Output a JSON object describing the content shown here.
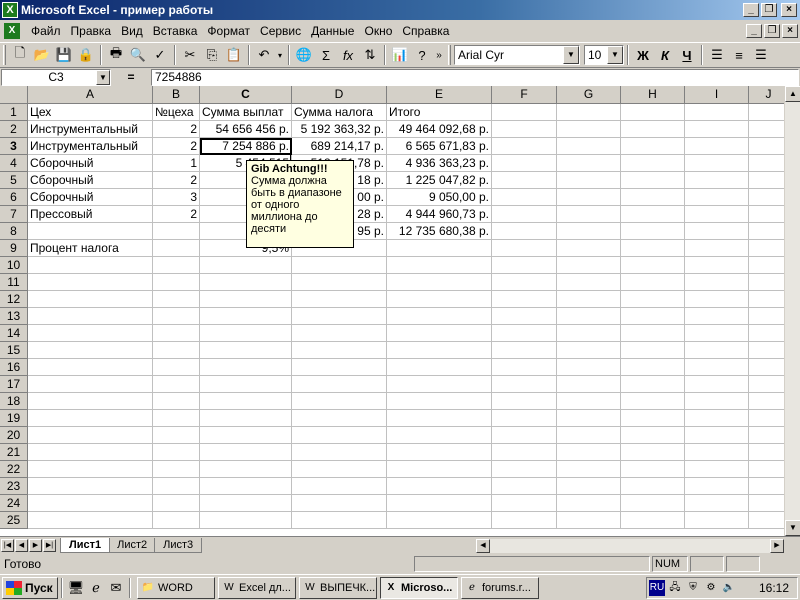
{
  "window": {
    "title": "Microsoft Excel - пример работы",
    "app_icon": "excel-icon"
  },
  "menu": [
    "Файл",
    "Правка",
    "Вид",
    "Вставка",
    "Формат",
    "Сервис",
    "Данные",
    "Окно",
    "Справка"
  ],
  "toolbar": {
    "font_name": "Arial Cyr",
    "font_size": "10",
    "bold": "Ж",
    "italic": "К",
    "underline": "Ч"
  },
  "formula_bar": {
    "name_box": "C3",
    "equals": "=",
    "formula": "7254886"
  },
  "columns": [
    "A",
    "B",
    "C",
    "D",
    "E",
    "F",
    "G",
    "H",
    "I",
    "J"
  ],
  "rows": [
    {
      "n": "1",
      "A": "Цех",
      "B": "№цеха",
      "C": "Сумма выплат",
      "D": "Сумма налога",
      "E": "Итого"
    },
    {
      "n": "2",
      "A": "Инструментальный",
      "B": "2",
      "C": "54 656 456 р.",
      "D": "5 192 363,32 р.",
      "E": "49 464 092,68 р."
    },
    {
      "n": "3",
      "A": "Инструментальный",
      "B": "2",
      "C": "7 254 886 р.",
      "D": "689 214,17 р.",
      "E": "6 565 671,83 р."
    },
    {
      "n": "4",
      "A": "Сборочный",
      "B": "1",
      "C": "5 454 515",
      "D": "518 151,78 р.",
      "E": "4 936 363,23 р."
    },
    {
      "n": "5",
      "A": "Сборочный",
      "B": "2",
      "C": "1 353",
      "D": "18 р.",
      "E": "1 225 047,82 р."
    },
    {
      "n": "6",
      "A": "Сборочный",
      "B": "3",
      "C": "10",
      "D": "00 р.",
      "E": "9 050,00 р."
    },
    {
      "n": "7",
      "A": "Прессовый",
      "B": "2",
      "C": "5 464",
      "D": "28 р.",
      "E": "4 944 960,73 р."
    },
    {
      "n": "8",
      "A": "",
      "B": "",
      "C": "14 072",
      "D": "95 р.",
      "E": "12 735 680,38 р."
    },
    {
      "n": "9",
      "A": "Процент налога",
      "B": "",
      "C": "9,5%",
      "D": "",
      "E": ""
    },
    {
      "n": "10"
    },
    {
      "n": "11"
    },
    {
      "n": "12"
    },
    {
      "n": "13"
    },
    {
      "n": "14"
    },
    {
      "n": "15"
    },
    {
      "n": "16"
    },
    {
      "n": "17"
    },
    {
      "n": "18"
    },
    {
      "n": "19"
    },
    {
      "n": "20"
    },
    {
      "n": "21"
    },
    {
      "n": "22"
    },
    {
      "n": "23"
    },
    {
      "n": "24"
    },
    {
      "n": "25"
    }
  ],
  "comment": {
    "author": "Gib Achtung!!!",
    "text": "Сумма должна быть в диапазоне от одного миллиона до десяти"
  },
  "sheets": [
    "Лист1",
    "Лист2",
    "Лист3"
  ],
  "status": {
    "text": "Готово",
    "num": "NUM"
  },
  "taskbar": {
    "start": "Пуск",
    "buttons": [
      "WORD",
      "Excel дл...",
      "ВЫПЕЧК...",
      "Microso...",
      "forums.r..."
    ],
    "lang": "RU",
    "clock": "16:12"
  }
}
